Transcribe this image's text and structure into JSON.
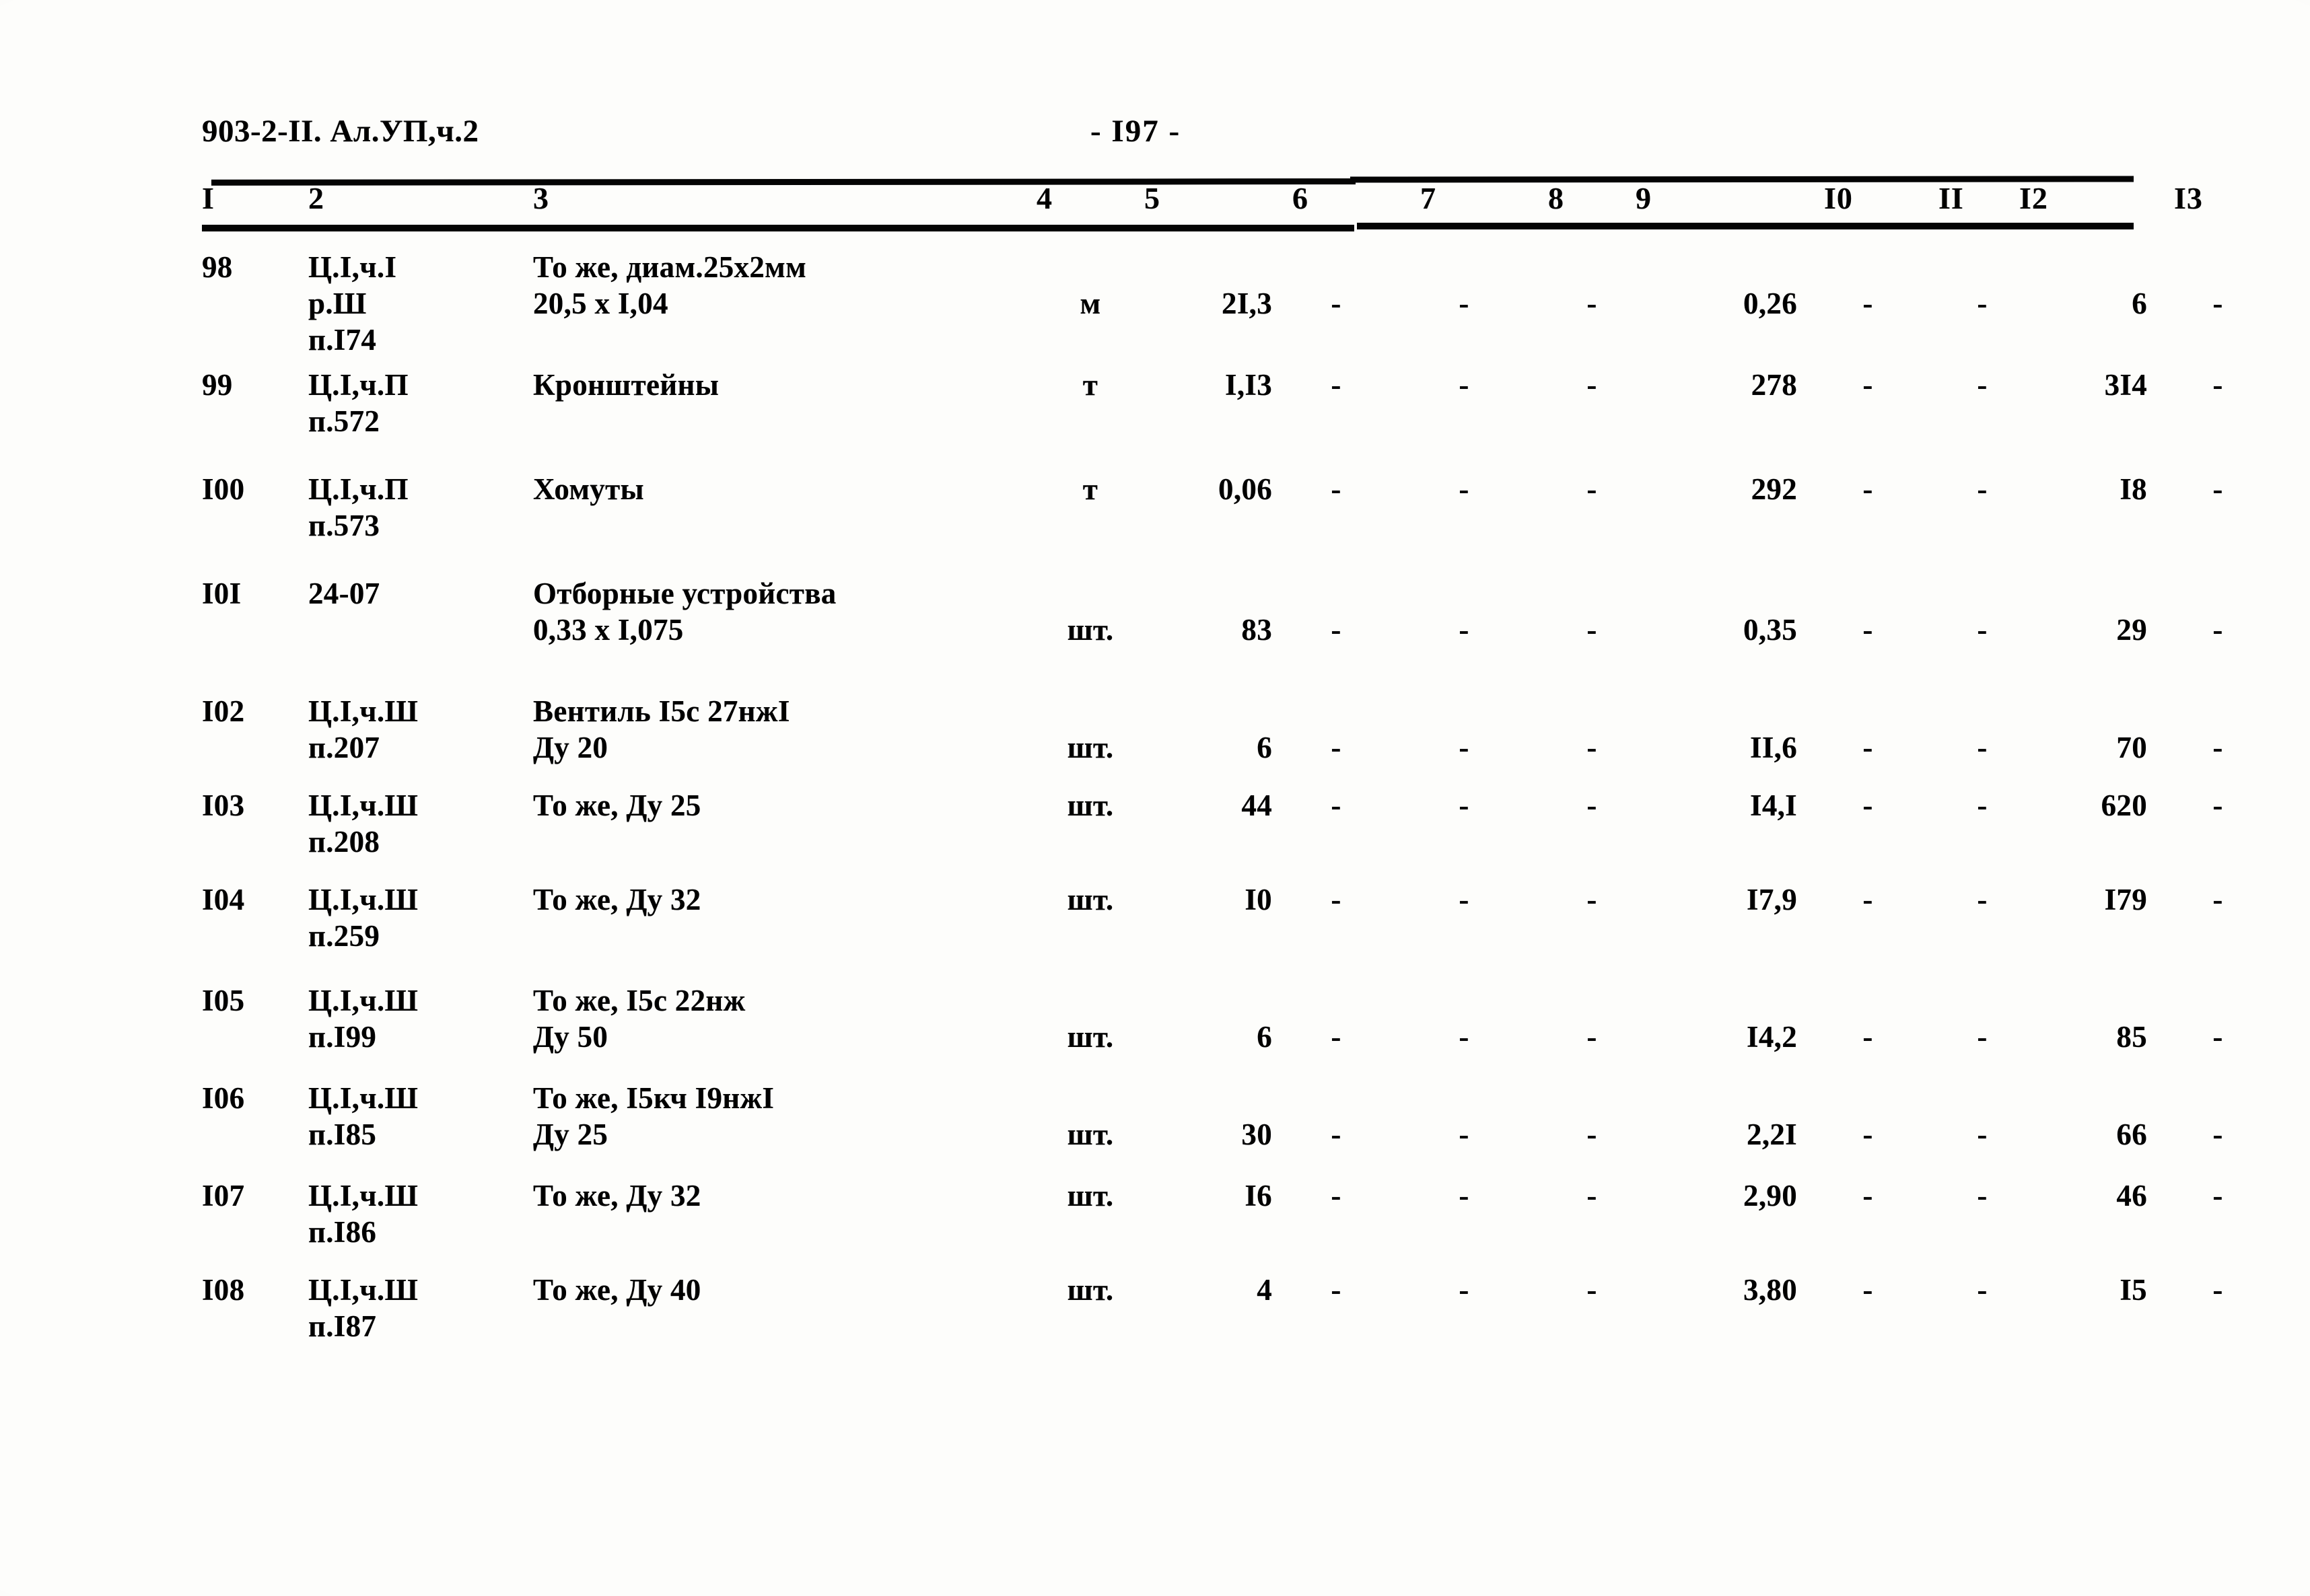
{
  "header": {
    "doc_code": "903-2-II. Ал.УП,ч.2",
    "page_number": "- I97 -"
  },
  "table": {
    "column_numbers": [
      "I",
      "2",
      "3",
      "4",
      "5",
      "6",
      "7",
      "8",
      "9",
      "I0",
      "II",
      "I2",
      "I3"
    ],
    "rows": [
      {
        "c1": "98",
        "c2": "Ц.I,ч.I\nр.Ш\nп.I74",
        "c3": "То же, диам.25х2мм\n20,5 х I,04",
        "c4": "м",
        "c5": "2I,3",
        "c6": "-",
        "c7": "-",
        "c8": "-",
        "c9": "0,26",
        "c10": "-",
        "c11": "-",
        "c12": "6",
        "c13": "-"
      },
      {
        "c1": "99",
        "c2": "Ц.I,ч.П\nп.572",
        "c3": "Кронштейны",
        "c4": "т",
        "c5": "I,I3",
        "c6": "-",
        "c7": "-",
        "c8": "-",
        "c9": "278",
        "c10": "-",
        "c11": "-",
        "c12": "3I4",
        "c13": "-"
      },
      {
        "c1": "I00",
        "c2": "Ц.I,ч.П\nп.573",
        "c3": "Хомуты",
        "c4": "т",
        "c5": "0,06",
        "c6": "-",
        "c7": "-",
        "c8": "-",
        "c9": "292",
        "c10": "-",
        "c11": "-",
        "c12": "I8",
        "c13": "-"
      },
      {
        "c1": "I0I",
        "c2": "24-07",
        "c3": "Отборные устройства\n0,33 х I,075",
        "c4": "шт.",
        "c5": "83",
        "c6": "-",
        "c7": "-",
        "c8": "-",
        "c9": "0,35",
        "c10": "-",
        "c11": "-",
        "c12": "29",
        "c13": "-"
      },
      {
        "c1": "I02",
        "c2": "Ц.I,ч.Ш\nп.207",
        "c3": "Вентиль I5с 27нжI\nДу 20",
        "c4": "шт.",
        "c5": "6",
        "c6": "-",
        "c7": "-",
        "c8": "-",
        "c9": "II,6",
        "c10": "-",
        "c11": "-",
        "c12": "70",
        "c13": "-"
      },
      {
        "c1": "I03",
        "c2": "Ц.I,ч.Ш\nп.208",
        "c3": "То же, Ду 25",
        "c4": "шт.",
        "c5": "44",
        "c6": "-",
        "c7": "-",
        "c8": "-",
        "c9": "I4,I",
        "c10": "-",
        "c11": "-",
        "c12": "620",
        "c13": "-"
      },
      {
        "c1": "I04",
        "c2": "Ц.I,ч.Ш\nп.259",
        "c3": "То же, Ду 32",
        "c4": "шт.",
        "c5": "I0",
        "c6": "-",
        "c7": "-",
        "c8": "-",
        "c9": "I7,9",
        "c10": "-",
        "c11": "-",
        "c12": "I79",
        "c13": "-"
      },
      {
        "c1": "I05",
        "c2": "Ц.I,ч.Ш\nп.I99",
        "c3": "То же, I5с 22нж\nДу 50",
        "c4": "шт.",
        "c5": "6",
        "c6": "-",
        "c7": "-",
        "c8": "-",
        "c9": "I4,2",
        "c10": "-",
        "c11": "-",
        "c12": "85",
        "c13": "-"
      },
      {
        "c1": "I06",
        "c2": "Ц.I,ч.Ш\nп.I85",
        "c3": "То же, I5кч I9нжI\nДу 25",
        "c4": "шт.",
        "c5": "30",
        "c6": "-",
        "c7": "-",
        "c8": "-",
        "c9": "2,2I",
        "c10": "-",
        "c11": "-",
        "c12": "66",
        "c13": "-"
      },
      {
        "c1": "I07",
        "c2": "Ц.I,ч.Ш\nп.I86",
        "c3": "То же, Ду 32",
        "c4": "шт.",
        "c5": "I6",
        "c6": "-",
        "c7": "-",
        "c8": "-",
        "c9": "2,90",
        "c10": "-",
        "c11": "-",
        "c12": "46",
        "c13": "-"
      },
      {
        "c1": "I08",
        "c2": "Ц.I,ч.Ш\nп.I87",
        "c3": "То же, Ду 40",
        "c4": "шт.",
        "c5": "4",
        "c6": "-",
        "c7": "-",
        "c8": "-",
        "c9": "3,80",
        "c10": "-",
        "c11": "-",
        "c12": "I5",
        "c13": "-"
      }
    ]
  },
  "layout": {
    "col_x": [
      0,
      158,
      492,
      1240,
      1400,
      1620,
      1810,
      2000,
      2130,
      2410,
      2580,
      2700,
      2930
    ],
    "row_top": [
      0,
      175,
      330,
      485,
      660,
      800,
      940,
      1090,
      1235,
      1380,
      1520
    ],
    "row_value_offset": [
      54,
      0,
      0,
      54,
      54,
      0,
      0,
      54,
      54,
      0,
      0
    ]
  }
}
